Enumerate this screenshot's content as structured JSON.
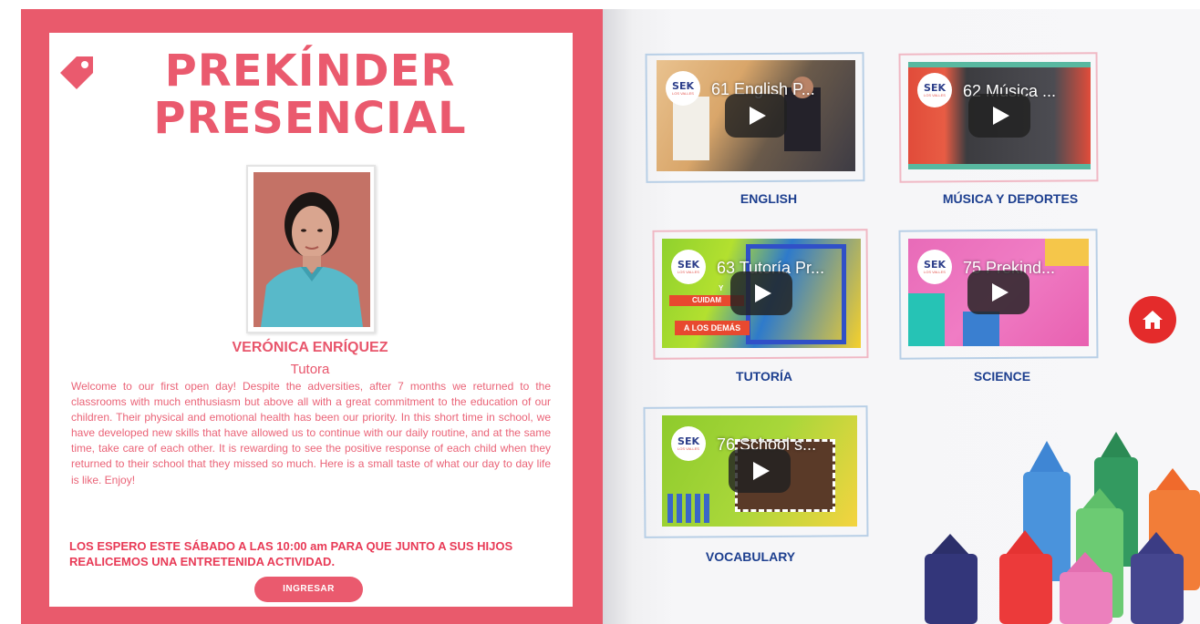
{
  "left_page": {
    "title_line1": "PREKÍNDER",
    "title_line2": "PRESENCIAL",
    "teacher_name": "VERÓNICA ENRÍQUEZ",
    "teacher_role": "Tutora",
    "welcome_text": "Welcome to our first open day! Despite the adversities, after 7 months we returned to the classrooms with much enthusiasm but above all with a great commitment to the education of our children. Their physical and emotional health has been our priority. In this short time in school, we have developed new skills that have allowed us to continue with our daily routine, and at the same time, take care of each other. It is rewarding to see the positive response of each child when they returned to their school that they missed so much. Here is a small taste of what our day to day life is like. Enjoy!",
    "invite_text": "LOS ESPERO ESTE SÁBADO A LAS 10:00 am PARA QUE JUNTO A SUS HIJOS REALICEMOS UNA ENTRETENIDA ACTIVIDAD.",
    "enter_button": "INGRESAR",
    "accent_color": "#e95a6c"
  },
  "logo": {
    "main": "SEK",
    "sub": "LOS VALLES"
  },
  "videos": [
    {
      "title": "61 English P...",
      "label": "ENGLISH",
      "frame": "blue"
    },
    {
      "title": "62 Música ...",
      "label": "MÚSICA Y DEPORTES",
      "frame": "pink"
    },
    {
      "title": "63 Tutoría Pr...",
      "label": "TUTORÍA",
      "frame": "pink",
      "overlay_1": "Y",
      "overlay_2": "CUIDAM",
      "overlay_3": "A LOS DEMÁS"
    },
    {
      "title": "75 Prekind...",
      "label": "SCIENCE",
      "frame": "blue"
    },
    {
      "title": "76 School s...",
      "label": "VOCABULARY",
      "frame": "blue"
    }
  ],
  "icons": {
    "tag": "tag-icon",
    "home": "home-icon",
    "play": "play-icon"
  },
  "colors": {
    "label_blue": "#1d3f8f",
    "home_red": "#e42b2b"
  }
}
